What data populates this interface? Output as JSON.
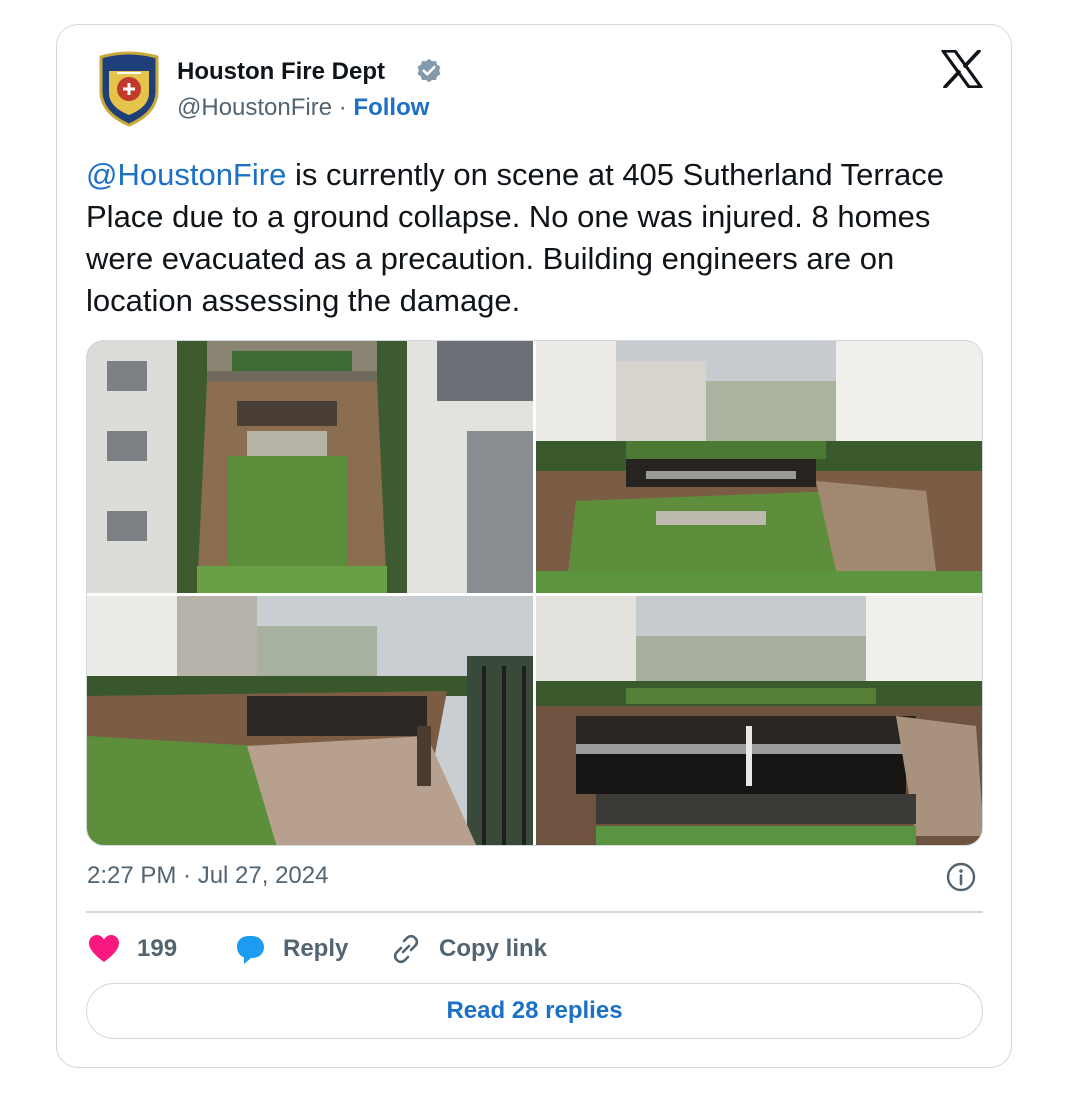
{
  "author": {
    "display_name": "Houston Fire Dept",
    "handle": "@HoustonFire",
    "separator": " · ",
    "follow_label": "Follow",
    "verified": true
  },
  "tweet": {
    "mention": "@HoustonFire",
    "body": " is currently on scene at  405 Sutherland Terrace Place due to a ground collapse.  No one was injured. 8 homes were evacuated as a precaution.  Building engineers are on location assessing the damage.",
    "timestamp": "2:27 PM · Jul 27, 2024",
    "media": [
      {
        "name": "aerial-view-of-collapse"
      },
      {
        "name": "collapse-side-view"
      },
      {
        "name": "collapse-walkway-view"
      },
      {
        "name": "collapse-front-view"
      }
    ]
  },
  "actions": {
    "like_count": "199",
    "reply_label": "Reply",
    "copy_link_label": "Copy link"
  },
  "read_replies_label": "Read 28 replies",
  "colors": {
    "accent": "#1d70c7",
    "like": "#f91880",
    "reply": "#1d9bf0",
    "verified_badge": "#829aab",
    "muted": "#536471",
    "border": "#cfd9de"
  },
  "icons": [
    "fire-dept-logo-icon",
    "verified-badge-icon",
    "x-logo-icon",
    "info-icon",
    "heart-icon",
    "reply-bubble-icon",
    "link-icon"
  ]
}
